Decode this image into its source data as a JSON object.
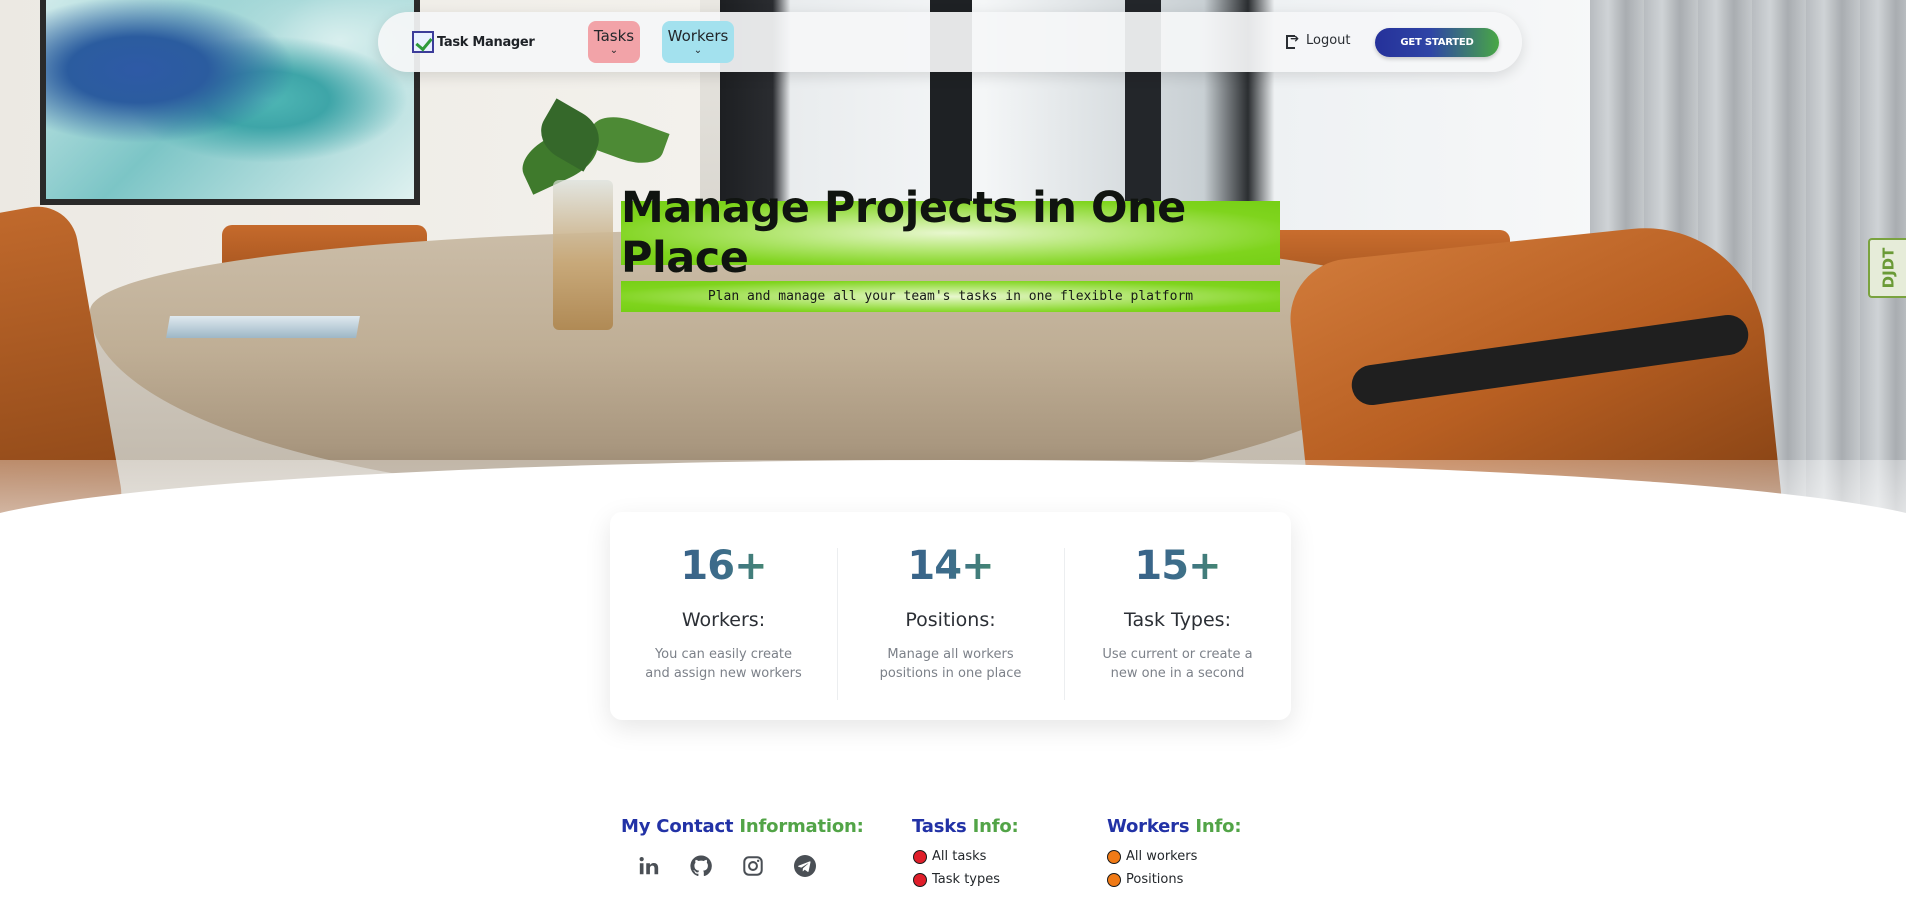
{
  "brand": {
    "name": "Task Manager"
  },
  "nav": {
    "tasks_label": "Tasks",
    "workers_label": "Workers",
    "logout_label": "Logout",
    "get_started_label": "GET STARTED"
  },
  "hero": {
    "title": "Manage Projects in One Place",
    "subtitle": "Plan and manage all your team's tasks in one flexible platform"
  },
  "side_tab": {
    "label": "DJDT"
  },
  "stats": [
    {
      "number_main": "16",
      "number_suffix": "+",
      "title": "Workers:",
      "description": "You can easily create and assign new workers"
    },
    {
      "number_main": "14",
      "number_suffix": "+",
      "title": "Positions:",
      "description": "Manage all workers positions in one place"
    },
    {
      "number_main": "15",
      "number_suffix": "+",
      "title": "Task Types:",
      "description": "Use current or create a new one in a second"
    }
  ],
  "footer": {
    "contact": {
      "heading_part1": "My Contact ",
      "heading_part2": "Information:"
    },
    "tasks_info": {
      "heading_part1": "Tasks ",
      "heading_part2": "Info:",
      "items": [
        "All tasks",
        "Task types"
      ]
    },
    "workers_info": {
      "heading_part1": "Workers ",
      "heading_part2": "Info:",
      "items": [
        "All workers",
        "Positions"
      ]
    },
    "social_icons": [
      "linkedin-icon",
      "github-icon",
      "instagram-icon",
      "telegram-icon"
    ]
  },
  "colors": {
    "accent_green": "#7fd41d",
    "brand_blue": "#2232a6",
    "brand_green": "#52a447",
    "tasks_pill": "#f2a3a8",
    "workers_pill": "#a3e1ee",
    "dot_red": "#e01e2a",
    "dot_orange": "#f07a16"
  }
}
